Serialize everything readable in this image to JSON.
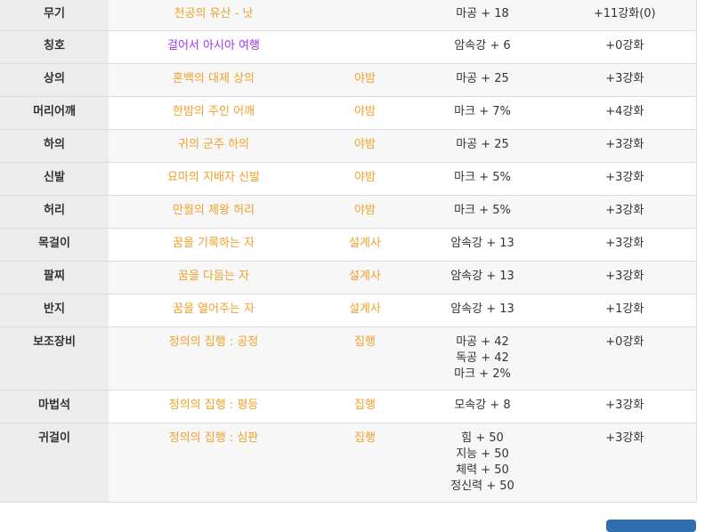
{
  "equipment": [
    {
      "slot": "무기",
      "name": "천공의 유산 - 낫",
      "rarity": "unique",
      "set": "",
      "stats": [
        "마공 + 18"
      ],
      "upgrade": "+11강화(0)"
    },
    {
      "slot": "칭호",
      "name": "걸어서 아시아 여행",
      "rarity": "epic",
      "set": "",
      "stats": [
        "암속강 + 6"
      ],
      "upgrade": "+0강화"
    },
    {
      "slot": "상의",
      "name": "혼백의 대제 상의",
      "rarity": "unique",
      "set": "야밤",
      "stats": [
        "마공 + 25"
      ],
      "upgrade": "+3강화"
    },
    {
      "slot": "머리어깨",
      "name": "한밤의 주인 어깨",
      "rarity": "unique",
      "set": "야밤",
      "stats": [
        "마크 + 7%"
      ],
      "upgrade": "+4강화"
    },
    {
      "slot": "하의",
      "name": "귀의 군주 하의",
      "rarity": "unique",
      "set": "야밤",
      "stats": [
        "마공 + 25"
      ],
      "upgrade": "+3강화"
    },
    {
      "slot": "신발",
      "name": "요마의 지배자 신발",
      "rarity": "unique",
      "set": "야밤",
      "stats": [
        "마크 + 5%"
      ],
      "upgrade": "+3강화"
    },
    {
      "slot": "허리",
      "name": "만월의 제왕 허리",
      "rarity": "unique",
      "set": "야밤",
      "stats": [
        "마크 + 5%"
      ],
      "upgrade": "+3강화"
    },
    {
      "slot": "목걸이",
      "name": "꿈을 기록하는 자",
      "rarity": "unique",
      "set": "설계사",
      "stats": [
        "암속강 + 13"
      ],
      "upgrade": "+3강화"
    },
    {
      "slot": "팔찌",
      "name": "꿈을 다듬는 자",
      "rarity": "unique",
      "set": "설계사",
      "stats": [
        "암속강 + 13"
      ],
      "upgrade": "+3강화"
    },
    {
      "slot": "반지",
      "name": "꿈을 열어주는 자",
      "rarity": "unique",
      "set": "설계사",
      "stats": [
        "암속강 + 13"
      ],
      "upgrade": "+1강화"
    },
    {
      "slot": "보조장비",
      "name": "정의의 집행 : 공정",
      "rarity": "unique",
      "set": "집행",
      "stats": [
        "마공 + 42",
        "독공 + 42",
        "마크 + 2%"
      ],
      "upgrade": "+0강화"
    },
    {
      "slot": "마법석",
      "name": "정의의 집행 : 평등",
      "rarity": "unique",
      "set": "집행",
      "stats": [
        "모속강 + 8"
      ],
      "upgrade": "+3강화"
    },
    {
      "slot": "귀걸이",
      "name": "정의의 집행 : 심판",
      "rarity": "unique",
      "set": "집행",
      "stats": [
        "힘 + 50",
        "지능 + 50",
        "체력 + 50",
        "정신력 + 50"
      ],
      "upgrade": "+3강화"
    }
  ],
  "colors": {
    "epic": "#a335ee",
    "unique": "#f0a12b",
    "slot_bg": "#ececec",
    "button": "#2f6fb0"
  }
}
